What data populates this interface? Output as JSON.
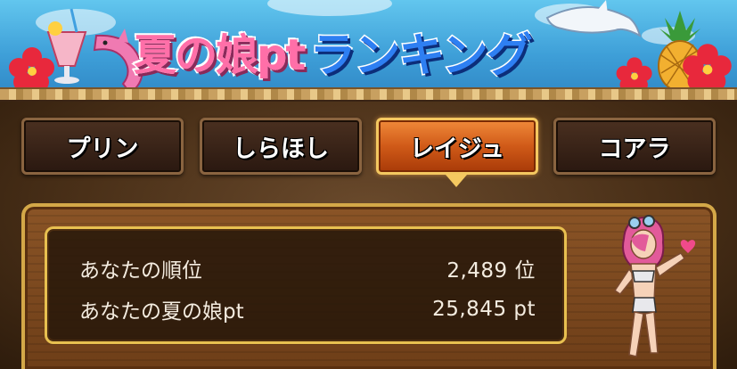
{
  "banner": {
    "title_part1": "夏の娘pt",
    "title_part2": "ランキング"
  },
  "tabs": [
    {
      "label": "プリン",
      "active": false
    },
    {
      "label": "しらほし",
      "active": false
    },
    {
      "label": "レイジュ",
      "active": true
    },
    {
      "label": "コアラ",
      "active": false
    }
  ],
  "stats": {
    "rank_label": "あなたの順位",
    "rank_value": "2,489 位",
    "pt_label": "あなたの夏の娘pt",
    "pt_value": "25,845 pt"
  },
  "colors": {
    "title_pink": "#ff6fa8",
    "title_blue": "#2e7ff2",
    "active_tab": "#e0701e",
    "frame_gold": "#e8c050"
  }
}
